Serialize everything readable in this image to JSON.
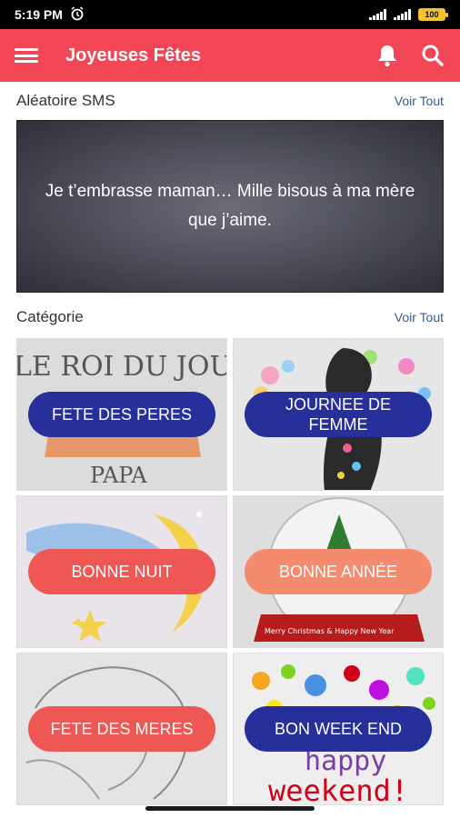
{
  "status": {
    "time": "5:19 PM",
    "battery": "100"
  },
  "app": {
    "title": "Joyeuses Fêtes"
  },
  "random_sms": {
    "title": "Aléatoire SMS",
    "see_all": "Voir Tout",
    "text": "Je t’embrasse maman… Mille bisous à ma mère que j’aime."
  },
  "category": {
    "title": "Catégorie",
    "see_all": "Voir Tout",
    "items": [
      {
        "label": "FETE DES PERES",
        "image_text": "LE ROI DU JOUR",
        "image_subtext": "PAPA"
      },
      {
        "label": "JOURNEE DE FEMME"
      },
      {
        "label": "BONNE NUIT"
      },
      {
        "label": "BONNE ANNÉE",
        "image_text": "Merry Christmas & Happy New Year"
      },
      {
        "label": "FETE DES MERES"
      },
      {
        "label": "BON WEEK END",
        "image_text": "happy",
        "image_subtext": "weekend!"
      }
    ]
  },
  "colors": {
    "primary": "#f24656",
    "pill_blue": "#27309a",
    "pill_red": "#ef5754",
    "pill_orange": "#f48a6e",
    "link": "#2d5f9a"
  },
  "icons": {
    "menu": "menu-icon",
    "bell": "bell-icon",
    "search": "search-icon",
    "alarm": "alarm-icon"
  }
}
